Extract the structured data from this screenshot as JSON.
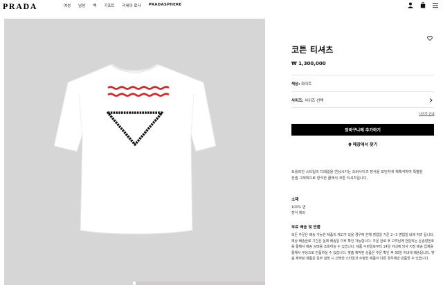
{
  "header": {
    "logo": "PRADA",
    "nav": [
      "여성",
      "남성",
      "백",
      "기프트",
      "리네아 로사",
      "PRADASPHERE"
    ],
    "icons": [
      "user-icon",
      "bag-icon",
      "menu-icon"
    ]
  },
  "product": {
    "title": "코튼 티셔츠",
    "price": "₩ 1,300,000",
    "color_label": "색상:",
    "color_value": "화이트",
    "size_label": "사이즈:",
    "size_value": "사이즈 선택",
    "size_guide": "사이즈 안내",
    "add_to_cart": "장바구니에 추가하기",
    "find_store": "매장에서 찾기",
    "description": "트롤리안 스타일의 디테일을 연상시키는 오버사이즈 장식을 모던하게 재해석하여 특별한 컨셉 그래픽으로 장식한 클래식 코튼 티셔츠입니다.",
    "material_heading": "소재",
    "material_lines": [
      "100% 면",
      "장식 제외"
    ],
    "shipping_heading": "무료 배송 및 반품",
    "shipping_text": "모든 주문은 배송 가능한 제품의 재고가 있을 경우에 한해 영업일 기준 2~3 영업일 내에 처리 됩니다. 예상 배송완료 기간은 실제 배송일 이후 확인 가능합니다. 주문 완료 후 고객님께 전달되는 운송장번호를 통해서 배송 상태를 조회하실 수 있습니다. 제품 수령일로부터 14일 이내에 당사 지정 배송 업체를 통해서 무상으로 반품하실 수 있습니다. 맞춤 제작된 상품은 주문 확인 후 30일 이내에 배송됩니다. 맞춤 제작된 제품은 일부 설정 시 선택한 스타일과 수량한 제품이 다른 경우에만 반품할 수 있습니다."
  },
  "colors": {
    "accent": "#000000",
    "photo_bg": "#d6d6d6",
    "stripe_red": "#d42a2a",
    "stripe_black": "#111111"
  }
}
